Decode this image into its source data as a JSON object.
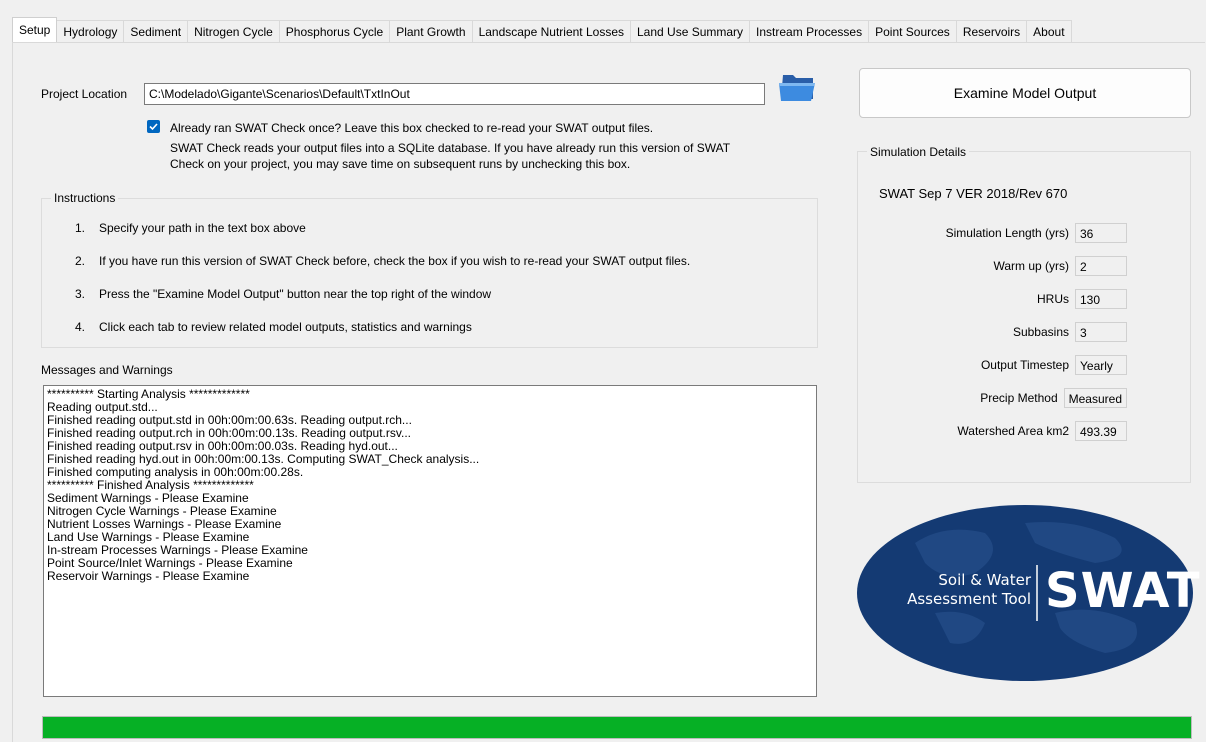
{
  "tabs": [
    "Setup",
    "Hydrology",
    "Sediment",
    "Nitrogen Cycle",
    "Phosphorus Cycle",
    "Plant Growth",
    "Landscape Nutrient Losses",
    "Land Use Summary",
    "Instream Processes",
    "Point Sources",
    "Reservoirs",
    "About"
  ],
  "setup": {
    "project_location_label": "Project Location",
    "project_location_value": "C:\\Modelado\\Gigante\\Scenarios\\Default\\TxtInOut",
    "folder_icon": "folder-icon",
    "checkbox_label": "Already ran SWAT Check once? Leave this box checked to re-read your SWAT output files.",
    "checkbox_checked": true,
    "checkbox_note_1": "SWAT Check reads your output files into a SQLite database. If you have already run this version of SWAT",
    "checkbox_note_2": "Check on your project, you may save time on subsequent runs by unchecking this box.",
    "instructions_title": "Instructions",
    "instructions": [
      {
        "num": "1.",
        "text": "Specify your path in the text box above"
      },
      {
        "num": "2.",
        "text": "If you have run this version of SWAT Check before, check the box if you wish to re-read your SWAT output files."
      },
      {
        "num": "3.",
        "text": "Press the \"Examine Model Output\" button near the top right of the window"
      },
      {
        "num": "4.",
        "text": "Click each tab to review related model outputs, statistics and warnings"
      }
    ],
    "messages_title": "Messages and Warnings",
    "messages": [
      "********** Starting Analysis *************",
      "Reading output.std...",
      "Finished reading output.std in 00h:00m:00.63s. Reading output.rch...",
      "Finished reading output.rch in 00h:00m:00.13s. Reading output.rsv...",
      "Finished reading output.rsv in 00h:00m:00.03s. Reading hyd.out...",
      "Finished reading hyd.out in 00h:00m:00.13s. Computing SWAT_Check analysis...",
      "Finished computing analysis in 00h:00m:00.28s.",
      "********** Finished Analysis *************",
      "Sediment Warnings - Please Examine",
      "Nitrogen Cycle Warnings - Please Examine",
      "Nutrient Losses Warnings - Please Examine",
      "Land Use Warnings - Please Examine",
      "In-stream Processes Warnings - Please Examine",
      "Point Source/Inlet Warnings - Please Examine",
      "Reservoir Warnings - Please Examine"
    ],
    "examine_button": "Examine Model Output",
    "sim_title": "Simulation Details",
    "sim_version": "SWAT Sep 7   VER 2018/Rev 670",
    "details": [
      {
        "label": "Simulation Length (yrs)",
        "value": "36"
      },
      {
        "label": "Warm up (yrs)",
        "value": "2"
      },
      {
        "label": "HRUs",
        "value": "130"
      },
      {
        "label": "Subbasins",
        "value": "3"
      },
      {
        "label": "Output Timestep",
        "value": "Yearly"
      },
      {
        "label": "Precip Method",
        "value": "Measured"
      },
      {
        "label": "Watershed Area km2",
        "value": "493.39"
      }
    ],
    "logo": {
      "line1": "Soil & Water",
      "line2": "Assessment Tool",
      "word": "SWAT"
    },
    "progress_fraction": 1.0
  },
  "colors": {
    "accent": "#0067c0",
    "progress": "#06b025",
    "logo_blue": "#143a73"
  }
}
